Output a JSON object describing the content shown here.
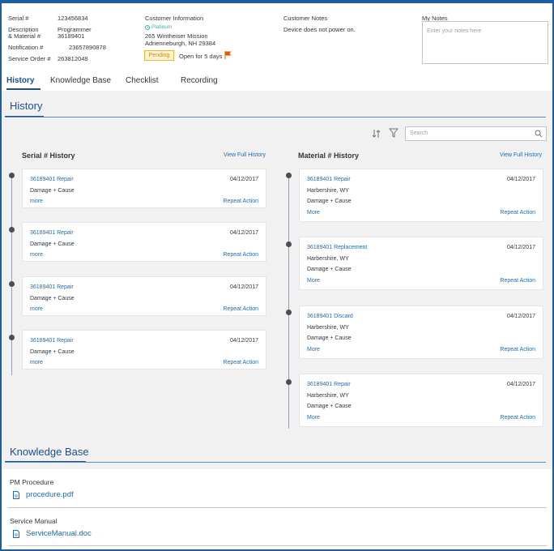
{
  "header": {
    "serial_label": "Serial #",
    "serial_value": "123456834",
    "desc_label_1": "Description",
    "desc_label_2": "& Material #",
    "desc_value_1": "Programmer",
    "desc_value_2": "36189401",
    "notification_label": "Notification #",
    "notification_value": "23657890878",
    "service_order_label": "Service Order #",
    "service_order_value": "263812048",
    "customer_info_title": "Customer Information",
    "customer_tier": "Platinum",
    "address_line_1": "265 Wintheiser Mission",
    "address_line_2": "Adrienneburgh, NH 29384",
    "status_badge": "Pending",
    "open_for": "Open for 5 days",
    "customer_notes_title": "Customer Notes",
    "customer_notes_text": "Device does not power on.",
    "my_notes_title": "My Notes",
    "my_notes_placeholder": "Enter your notes here"
  },
  "tabs": [
    {
      "label": "History"
    },
    {
      "label": "Knowledge Base"
    },
    {
      "label": "Checklist"
    },
    {
      "label": "Recording"
    }
  ],
  "history": {
    "title": "History",
    "search_placeholder": "Search",
    "serial_col": {
      "title": "Serial # History",
      "view_full": "View Full History",
      "items": [
        {
          "title": "36189401 Repair",
          "date": "04/12/2017",
          "line": "Damage + Cause",
          "more": "more",
          "action": "Repeat Action"
        },
        {
          "title": "36189401 Repair",
          "date": "04/12/2017",
          "line": "Damage + Cause",
          "more": "more",
          "action": "Repeat Action"
        },
        {
          "title": "36189401 Repair",
          "date": "04/12/2017",
          "line": "Damage + Cause",
          "more": "more",
          "action": "Repeat Action"
        },
        {
          "title": "36189401 Repair",
          "date": "04/12/2017",
          "line": "Damage + Cause",
          "more": "more",
          "action": "Repeat Action"
        }
      ]
    },
    "material_col": {
      "title": "Material # History",
      "view_full": "View Full History",
      "items": [
        {
          "title": "36189401 Repair",
          "date": "04/12/2017",
          "location": "Harbershire, WY",
          "line": "Damage + Cause",
          "more": "More",
          "action": "Repeat Action"
        },
        {
          "title": "36189401 Replacement",
          "date": "04/12/2017",
          "location": "Harbershire, WY",
          "line": "Damage + Cause",
          "more": "More",
          "action": "Repeat Action"
        },
        {
          "title": "36189401 Discard",
          "date": "04/12/2017",
          "location": "Harbershire, WY",
          "line": "Damage + Cause",
          "more": "More",
          "action": "Repeat Action"
        },
        {
          "title": "36189401 Repair",
          "date": "04/12/2017",
          "location": "Harbershire, WY",
          "line": "Damage + Cause",
          "more": "More",
          "action": "Repeat Action"
        }
      ]
    }
  },
  "knowledge_base": {
    "title": "Knowledge Base",
    "items": [
      {
        "label": "PM Procedure",
        "file": "procedure.pdf"
      },
      {
        "label": "Service Manual",
        "file": "ServiceManual.doc"
      }
    ]
  },
  "colors": {
    "accent": "#1d4f91",
    "link": "#1d6bb5",
    "pending_bg": "#fff3d6",
    "pending_border": "#f0b340",
    "flag": "#e35b00",
    "platinum": "#3ab0a6"
  }
}
